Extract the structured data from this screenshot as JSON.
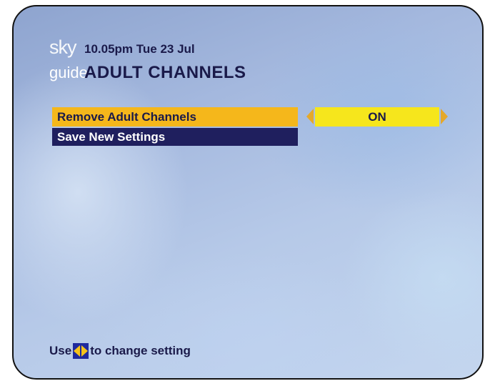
{
  "header": {
    "logo_sky": "sky",
    "logo_guide": "guide",
    "time": "10.05pm Tue 23 Jul",
    "title": "ADULT CHANNELS"
  },
  "menu": {
    "items": [
      {
        "label": "Remove Adult Channels",
        "value": "ON",
        "selected": true
      },
      {
        "label": "Save New Settings",
        "selected": false
      }
    ]
  },
  "footer": {
    "hint_prefix": "Use",
    "hint_icon": "left-right-arrows-icon",
    "hint_suffix": "to change setting"
  },
  "colors": {
    "selected_bg": "#f5b71b",
    "unselected_bg": "#1f1f5e",
    "value_bg": "#f6e61c",
    "text_dark": "#1a1a4a"
  }
}
